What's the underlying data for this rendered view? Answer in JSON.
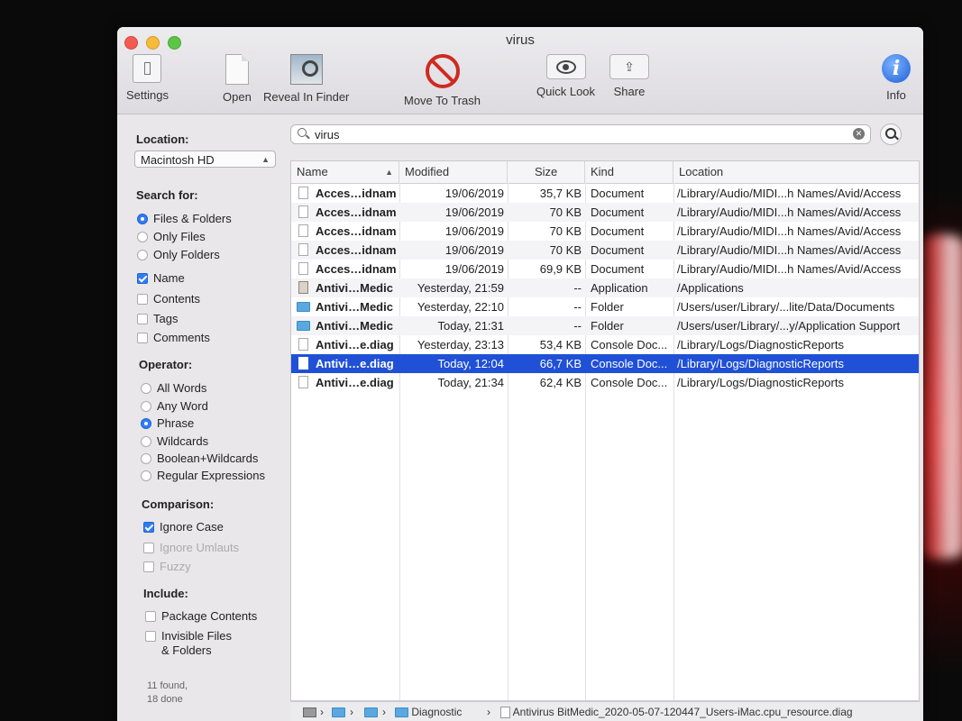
{
  "window": {
    "title": "virus"
  },
  "toolbar": {
    "settings": "Settings",
    "open": "Open",
    "reveal": "Reveal In Finder",
    "trash": "Move To Trash",
    "quicklook": "Quick Look",
    "share": "Share",
    "info": "Info"
  },
  "sidebar": {
    "location_label": "Location:",
    "location_value": "Macintosh HD",
    "search_for_label": "Search for:",
    "search_for": [
      "Files & Folders",
      "Only Files",
      "Only Folders"
    ],
    "fields": [
      "Name",
      "Contents",
      "Tags",
      "Comments"
    ],
    "operator_label": "Operator:",
    "operators": [
      "All Words",
      "Any Word",
      "Phrase",
      "Wildcards",
      "Boolean+Wildcards",
      "Regular Expressions"
    ],
    "comparison_label": "Comparison:",
    "comparison": [
      "Ignore Case",
      "Ignore Umlauts",
      "Fuzzy"
    ],
    "include_label": "Include:",
    "include": [
      "Package Contents",
      "Invisible Files",
      "& Folders"
    ],
    "status_found": "11 found,",
    "status_done": "18 done"
  },
  "search": {
    "query": "virus"
  },
  "table": {
    "columns": [
      "Name",
      "Modified",
      "Size",
      "Kind",
      "Location"
    ],
    "rows": [
      {
        "name": "Acces…idnam",
        "modified": "19/06/2019",
        "size": "35,7 KB",
        "kind": "Document",
        "location": "/Library/Audio/MIDI...h Names/Avid/Access"
      },
      {
        "name": "Acces…idnam",
        "modified": "19/06/2019",
        "size": "70 KB",
        "kind": "Document",
        "location": "/Library/Audio/MIDI...h Names/Avid/Access"
      },
      {
        "name": "Acces…idnam",
        "modified": "19/06/2019",
        "size": "70 KB",
        "kind": "Document",
        "location": "/Library/Audio/MIDI...h Names/Avid/Access"
      },
      {
        "name": "Acces…idnam",
        "modified": "19/06/2019",
        "size": "70 KB",
        "kind": "Document",
        "location": "/Library/Audio/MIDI...h Names/Avid/Access"
      },
      {
        "name": "Acces…idnam",
        "modified": "19/06/2019",
        "size": "69,9 KB",
        "kind": "Document",
        "location": "/Library/Audio/MIDI...h Names/Avid/Access"
      },
      {
        "name": "Antivi…Medic",
        "modified": "Yesterday, 21:59",
        "size": "--",
        "kind": "Application",
        "location": "/Applications"
      },
      {
        "name": "Antivi…Medic",
        "modified": "Yesterday, 22:10",
        "size": "--",
        "kind": "Folder",
        "location": "/Users/user/Library/...lite/Data/Documents"
      },
      {
        "name": "Antivi…Medic",
        "modified": "Today, 21:31",
        "size": "--",
        "kind": "Folder",
        "location": "/Users/user/Library/...y/Application Support"
      },
      {
        "name": "Antivi…e.diag",
        "modified": "Yesterday, 23:13",
        "size": "53,4 KB",
        "kind": "Console Doc...",
        "location": "/Library/Logs/DiagnosticReports"
      },
      {
        "name": "Antivi…e.diag",
        "modified": "Today, 12:04",
        "size": "66,7 KB",
        "kind": "Console Doc...",
        "location": "/Library/Logs/DiagnosticReports"
      },
      {
        "name": "Antivi…e.diag",
        "modified": "Today, 21:34",
        "size": "62,4 KB",
        "kind": "Console Doc...",
        "location": "/Library/Logs/DiagnosticReports"
      }
    ]
  },
  "pathbar": {
    "folder": "Diagnostic",
    "file": "Antivirus BitMedic_2020-05-07-120447_Users-iMac.cpu_resource.diag"
  },
  "colors": {
    "selection": "#1f50d6",
    "accent": "#2f7cf6",
    "trash": "#cf2a20"
  }
}
